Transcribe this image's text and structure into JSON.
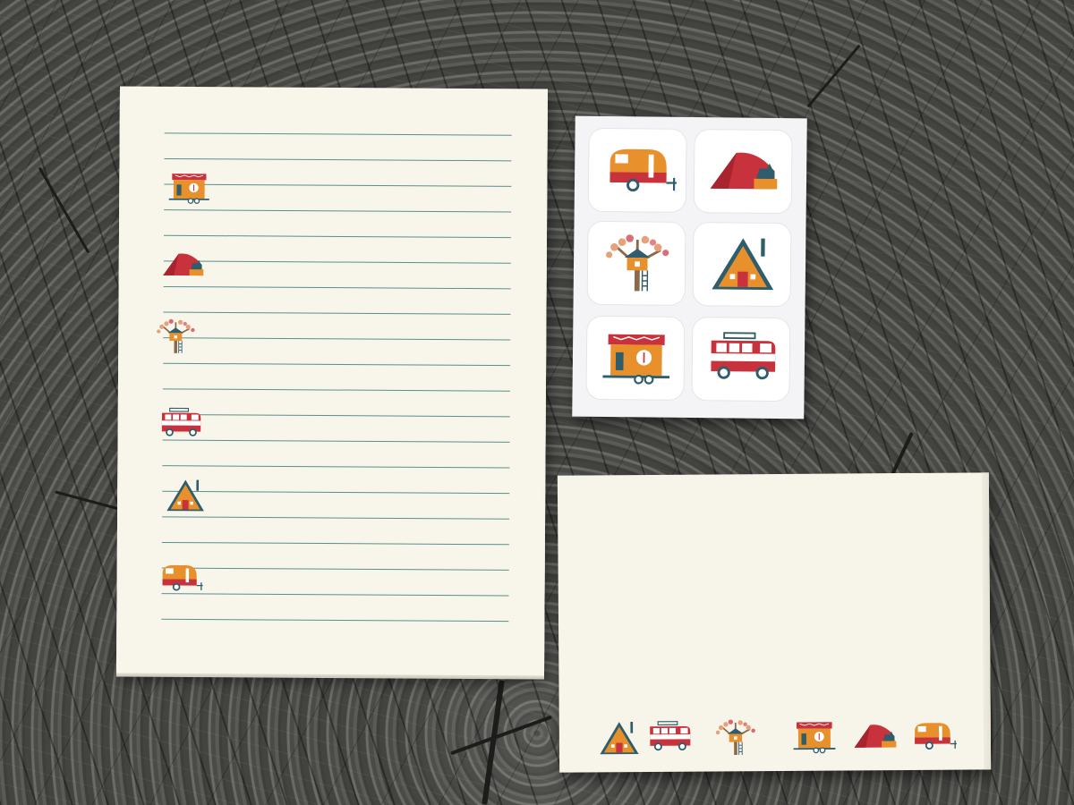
{
  "scene": {
    "objects": [
      "notepad",
      "sticker-sheet",
      "envelope"
    ],
    "surface": "weathered-wood-stump"
  },
  "notepad": {
    "line_count": 20,
    "line_color": "#5b8f8c",
    "paper_color": "#f8f5ea",
    "icons": [
      "tiny-house-icon",
      "tent-icon",
      "treehouse-icon",
      "camper-van-icon",
      "a-frame-icon",
      "trailer-icon"
    ]
  },
  "sticker_sheet": {
    "stickers": [
      "trailer-icon",
      "tent-icon",
      "treehouse-icon",
      "a-frame-icon",
      "tiny-house-icon",
      "camper-van-icon"
    ]
  },
  "envelope": {
    "icons": [
      "a-frame-icon",
      "camper-van-icon",
      "treehouse-icon",
      "tiny-house-icon",
      "tent-icon",
      "trailer-icon"
    ]
  },
  "palette": {
    "orange": "#e8912c",
    "red": "#c8323c",
    "teal": "#2f5d6b",
    "cream": "#f8f5ea",
    "tree_bark": "#8a6a4a",
    "leaf": "#e7a07a"
  }
}
